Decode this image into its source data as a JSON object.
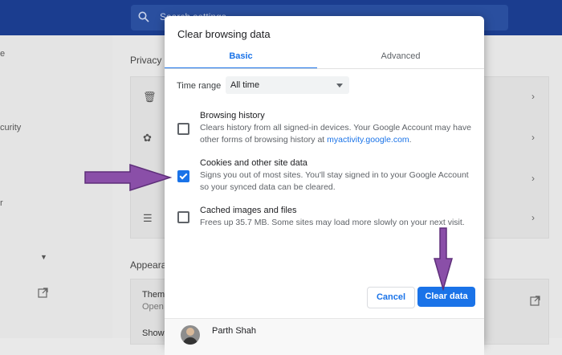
{
  "background": {
    "search_placeholder": "Search settings",
    "sidebar_texts": [
      "e",
      "curity",
      "r"
    ],
    "section1_title": "Privacy a",
    "section2_title": "Appeara",
    "theme_row_title": "Theme",
    "theme_row_sub": "Open",
    "show_row_title": "Show"
  },
  "dialog": {
    "title": "Clear browsing data",
    "tabs": [
      {
        "label": "Basic",
        "active": true
      },
      {
        "label": "Advanced",
        "active": false
      }
    ],
    "time_range": {
      "label": "Time range",
      "value": "All time"
    },
    "options": [
      {
        "title": "Browsing history",
        "desc_prefix": "Clears history from all signed-in devices. Your Google Account may have other forms of browsing history at ",
        "link": "myactivity.google.com",
        "desc_suffix": ".",
        "checked": false
      },
      {
        "title": "Cookies and other site data",
        "desc": "Signs you out of most sites. You'll stay signed in to your Google Account so your synced data can be cleared.",
        "checked": true
      },
      {
        "title": "Cached images and files",
        "desc": "Frees up 35.7 MB. Some sites may load more slowly on your next visit.",
        "checked": false
      }
    ],
    "cancel_label": "Cancel",
    "clear_label": "Clear data",
    "profile_name": "Parth Shah"
  },
  "colors": {
    "accent": "#1a73e8",
    "header": "#1b3d8f",
    "arrow": "#8a4fa8"
  }
}
